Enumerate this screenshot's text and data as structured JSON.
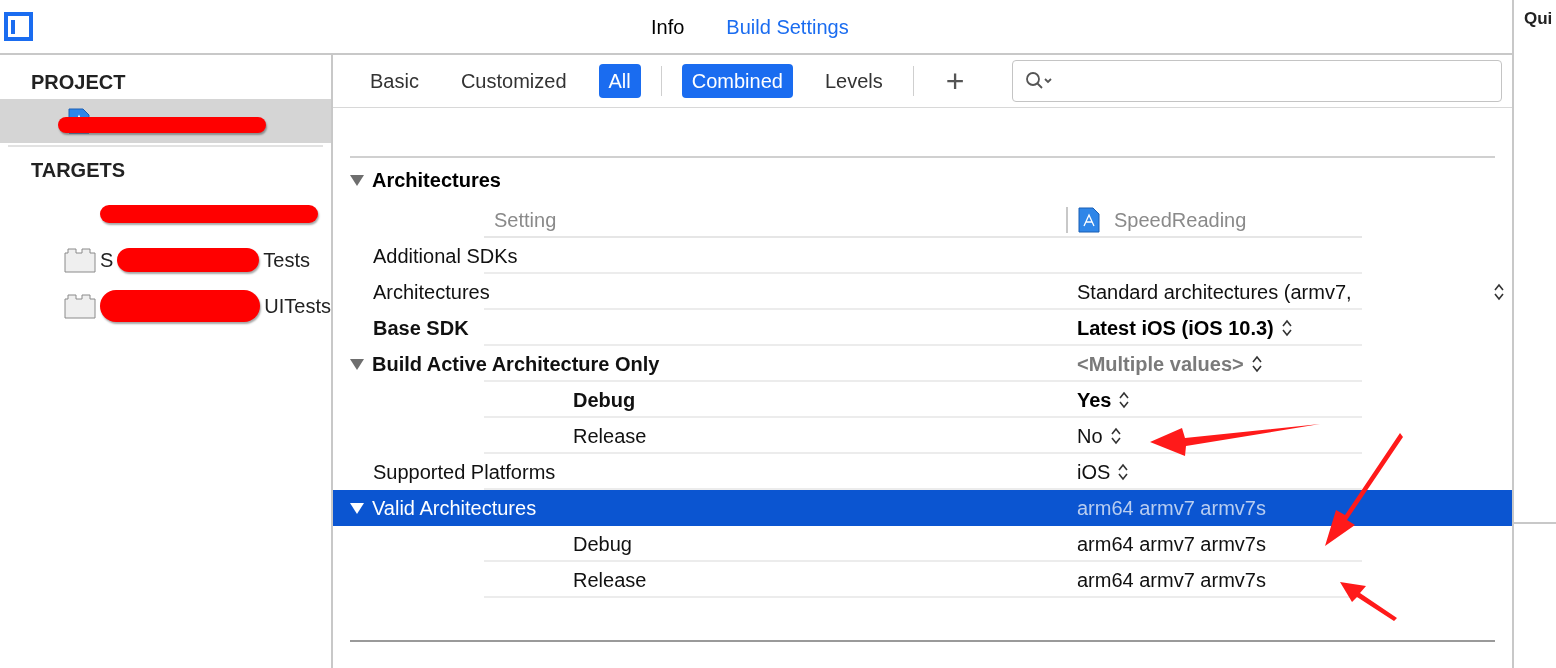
{
  "top_tabs": [
    {
      "label": "Info",
      "selected": false
    },
    {
      "label": "Build Settings",
      "selected": true
    }
  ],
  "inspector": {
    "title": "Qui"
  },
  "sidebar": {
    "project_header": "PROJECT",
    "project_item": {
      "kind": "project",
      "selected": true
    },
    "targets_header": "TARGETS",
    "targets": [
      {
        "kind": "app"
      },
      {
        "kind": "test",
        "fragments": [
          "S",
          "Tests"
        ]
      },
      {
        "kind": "test",
        "fragments": [
          "UITests"
        ]
      }
    ]
  },
  "filter_bar": {
    "groups": [
      [
        {
          "label": "Basic",
          "selected": false
        },
        {
          "label": "Customized",
          "selected": false
        },
        {
          "label": "All",
          "selected": true
        }
      ],
      [
        {
          "label": "Combined",
          "selected": true
        },
        {
          "label": "Levels",
          "selected": false
        }
      ]
    ],
    "add": "+"
  },
  "section": {
    "title": "Architectures",
    "expanded": true,
    "column_setting": "Setting",
    "column_target": "SpeedReading"
  },
  "rows": [
    {
      "kind": "setting",
      "name": "Additional SDKs",
      "modified": false,
      "selected": false
    },
    {
      "kind": "list",
      "name": "Architectures",
      "value": "Standard architectures (armv7,",
      "modified": false,
      "popup": true,
      "selected": false
    },
    {
      "kind": "setting",
      "name": "Base SDK",
      "modified": true,
      "value": "Latest iOS (iOS 10.3)",
      "popup": true,
      "selected": false
    },
    {
      "kind": "group",
      "name": "Build Active Architecture Only",
      "expanded": true,
      "modified": true,
      "value": "<Multiple values>",
      "popup": true,
      "selected": false
    },
    {
      "kind": "child",
      "name": "Debug",
      "modified": true,
      "value": "Yes",
      "popup": true,
      "selected": false
    },
    {
      "kind": "child",
      "name": "Release",
      "modified": false,
      "value": "No",
      "popup": true,
      "selected": false
    },
    {
      "kind": "setting",
      "name": "Supported Platforms",
      "modified": false,
      "value": "iOS",
      "popup": true,
      "selected": false
    },
    {
      "kind": "group",
      "name": "Valid Architectures",
      "expanded": true,
      "modified": false,
      "value": "arm64 armv7 armv7s",
      "popup": false,
      "selected": true
    },
    {
      "kind": "child",
      "name": "Debug",
      "modified": false,
      "value": "arm64 armv7 armv7s",
      "popup": false,
      "selected": false
    },
    {
      "kind": "child",
      "name": "Release",
      "modified": false,
      "value": "arm64 armv7 armv7s",
      "popup": false,
      "selected": false
    }
  ]
}
